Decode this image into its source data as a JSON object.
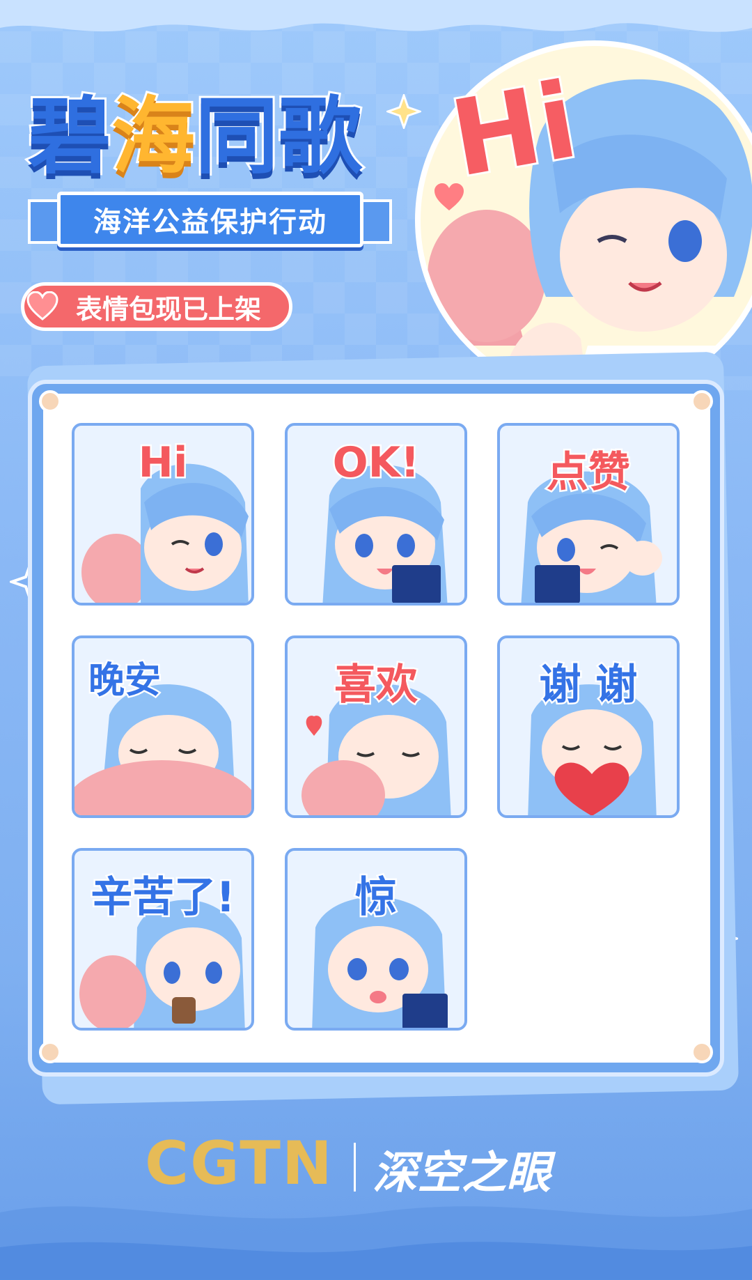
{
  "title": {
    "chars": [
      "碧",
      "海",
      "同",
      "歌"
    ]
  },
  "subtitle": "海洋公益保护行动",
  "badge": "表情包现已上架",
  "hero_text": "Hi",
  "stickers": [
    "Hi",
    "OK!",
    "点赞",
    "晚安",
    "喜欢",
    "谢 谢",
    "辛苦了!",
    "惊"
  ],
  "footer": {
    "logo": "CGTN",
    "brand": "深空之眼"
  },
  "colors": {
    "accent_blue": "#3473e6",
    "accent_red": "#f4595e",
    "gold": "#e6bb57"
  }
}
